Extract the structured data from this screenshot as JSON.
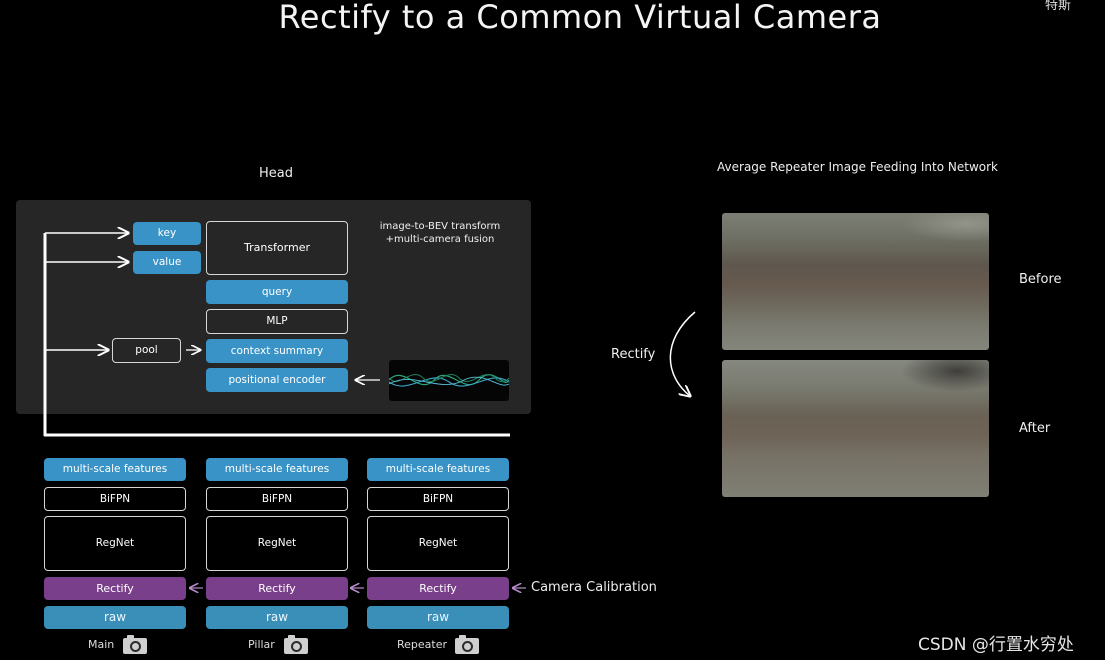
{
  "slide_title": "Rectify to a Common Virtual Camera",
  "corner_text": "特斯",
  "head": {
    "label": "Head",
    "key": "key",
    "value": "value",
    "transformer": "Transformer",
    "query": "query",
    "mlp": "MLP",
    "pool": "pool",
    "context_summary": "context summary",
    "positional_encoder": "positional encoder",
    "note_line1": "image-to-BEV transform",
    "note_line2": "+multi-camera fusion"
  },
  "columns": [
    {
      "features": "multi-scale features",
      "bifpn": "BiFPN",
      "regnet": "RegNet",
      "rectify": "Rectify",
      "raw": "raw",
      "camera": "Main"
    },
    {
      "features": "multi-scale features",
      "bifpn": "BiFPN",
      "regnet": "RegNet",
      "rectify": "Rectify",
      "raw": "raw",
      "camera": "Pillar"
    },
    {
      "features": "multi-scale features",
      "bifpn": "BiFPN",
      "regnet": "RegNet",
      "rectify": "Rectify",
      "raw": "raw",
      "camera": "Repeater"
    }
  ],
  "camera_calibration": "Camera Calibration",
  "right_panel": {
    "title": "Average Repeater Image Feeding Into Network",
    "before": "Before",
    "after": "After",
    "rectify": "Rectify"
  },
  "watermark": "CSDN @行置水穷处"
}
